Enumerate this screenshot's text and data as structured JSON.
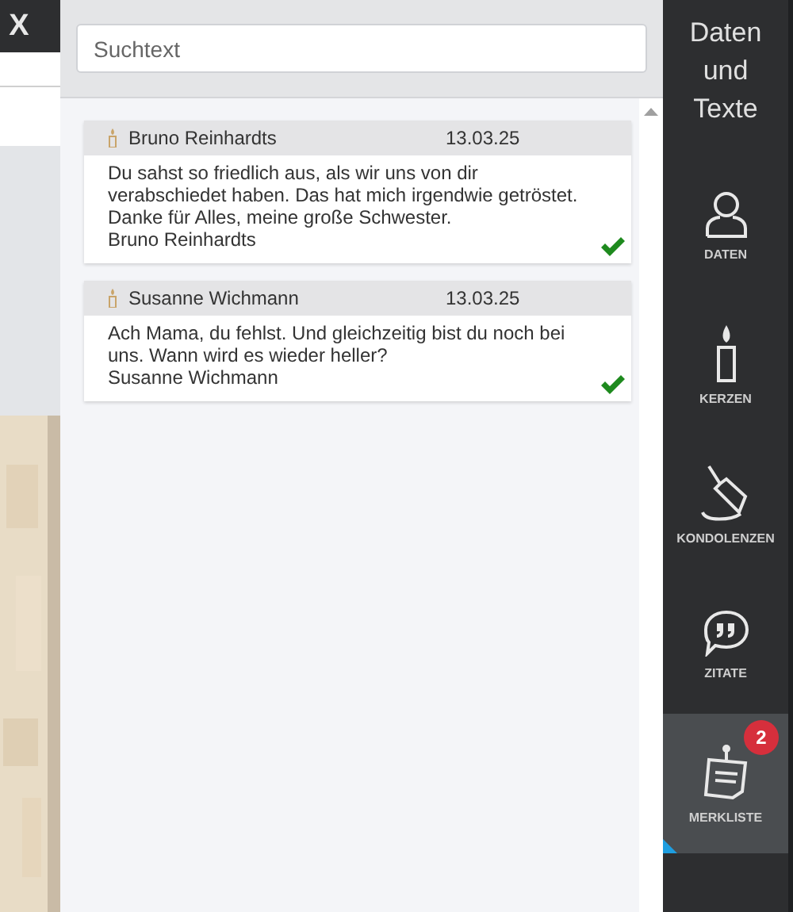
{
  "close_button": "X",
  "search": {
    "placeholder": "Suchtext"
  },
  "messages": [
    {
      "author": "Bruno Reinhardts",
      "date": "13.03.25",
      "text": "Du sahst so friedlich aus, als wir uns von dir verabschiedet haben. Das hat mich irgendwie getröstet. Danke für Alles, meine große Schwester.",
      "signature": "Bruno Reinhardts",
      "approved": true
    },
    {
      "author": "Susanne Wichmann",
      "date": "13.03.25",
      "text": "Ach Mama, du fehlst. Und gleichzeitig bist du noch bei uns. Wann wird es wieder heller?",
      "signature": "Susanne Wichmann",
      "approved": true
    }
  ],
  "sidebar": {
    "title": "Daten und Texte",
    "items": [
      {
        "kind": "person",
        "label": "DATEN",
        "selected": false
      },
      {
        "kind": "candle",
        "label": "KERZEN",
        "selected": false
      },
      {
        "kind": "pen",
        "label": "KONDOLENZEN",
        "selected": false
      },
      {
        "kind": "quote",
        "label": "ZITATE",
        "selected": false
      },
      {
        "kind": "note",
        "label": "MERKLISTE",
        "selected": true,
        "badge": "2"
      }
    ]
  }
}
